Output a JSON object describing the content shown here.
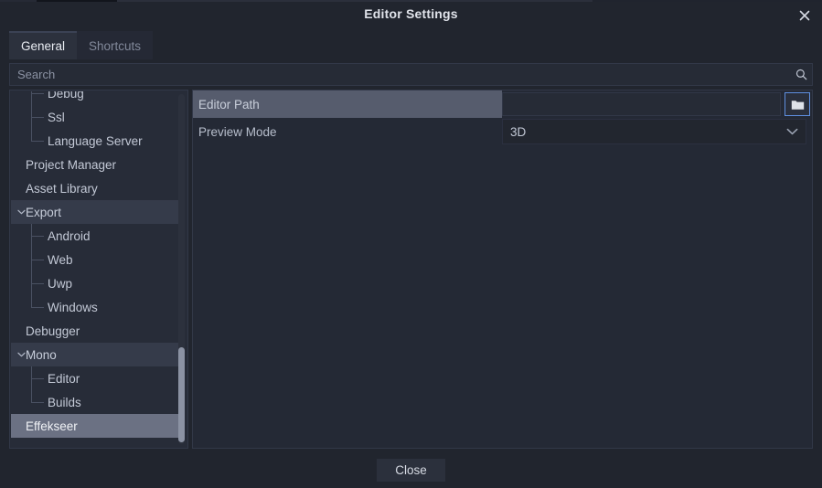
{
  "window": {
    "title": "Editor Settings",
    "close_icon": "close-x-icon"
  },
  "tabs": [
    {
      "label": "General",
      "active": true
    },
    {
      "label": "Shortcuts",
      "active": false
    }
  ],
  "search": {
    "placeholder": "Search",
    "value": "",
    "icon": "search-icon"
  },
  "tree": {
    "items": [
      {
        "label": "Debug",
        "depth": 2,
        "state": "normal",
        "clipped": true
      },
      {
        "label": "Ssl",
        "depth": 2,
        "state": "normal"
      },
      {
        "label": "Language Server",
        "depth": 2,
        "state": "normal",
        "last": true
      },
      {
        "label": "Project Manager",
        "depth": 1,
        "state": "normal"
      },
      {
        "label": "Asset Library",
        "depth": 1,
        "state": "normal"
      },
      {
        "label": "Export",
        "depth": 1,
        "state": "group",
        "expanded": true
      },
      {
        "label": "Android",
        "depth": 2,
        "state": "normal"
      },
      {
        "label": "Web",
        "depth": 2,
        "state": "normal"
      },
      {
        "label": "Uwp",
        "depth": 2,
        "state": "normal"
      },
      {
        "label": "Windows",
        "depth": 2,
        "state": "normal",
        "last": true
      },
      {
        "label": "Debugger",
        "depth": 1,
        "state": "normal"
      },
      {
        "label": "Mono",
        "depth": 1,
        "state": "group",
        "expanded": true
      },
      {
        "label": "Editor",
        "depth": 2,
        "state": "normal"
      },
      {
        "label": "Builds",
        "depth": 2,
        "state": "normal",
        "last": true
      },
      {
        "label": "Effekseer",
        "depth": 1,
        "state": "selected"
      }
    ],
    "scrollbar": "vertical-scrollbar"
  },
  "settings": {
    "rows": [
      {
        "label": "Editor Path",
        "label_highlighted": true,
        "control": "path",
        "value": "",
        "button_icon": "folder-icon"
      },
      {
        "label": "Preview Mode",
        "label_highlighted": false,
        "control": "dropdown",
        "value": "3D",
        "chevron_icon": "chevron-down-icon"
      }
    ]
  },
  "footer": {
    "close_label": "Close"
  },
  "colors": {
    "dialog_bg": "#21252e",
    "panel_bg": "#272c38",
    "selection": "#6b7183",
    "group_row": "#353b4a",
    "label_highlight": "#565c6d",
    "focus_border": "#5f8fe0",
    "text": "#c3c9d6",
    "text_dim": "#82899a"
  }
}
